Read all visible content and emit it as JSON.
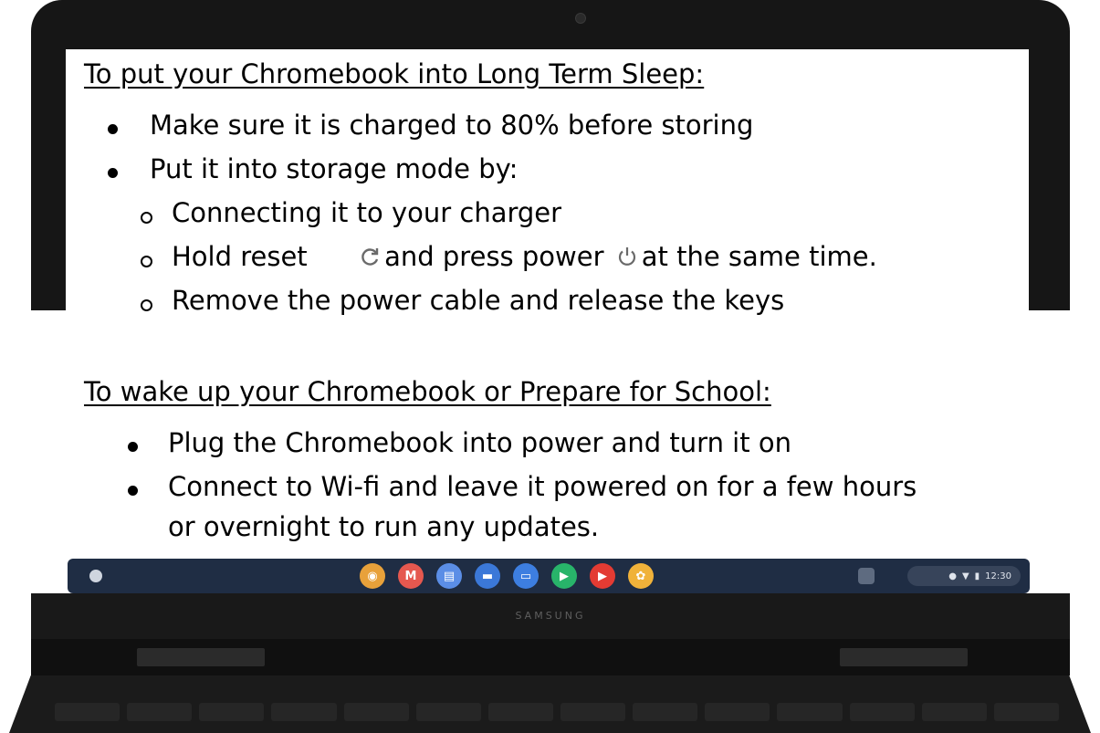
{
  "section1": {
    "heading": "To put your Chromebook into Long Term Sleep:",
    "bullets": [
      "Make sure it is charged to 80% before storing",
      "Put it into storage mode by:"
    ],
    "substeps": {
      "step1": "Connecting it to your charger",
      "step2_a": "Hold reset",
      "step2_b": "and press power",
      "step2_c": "at the same time.",
      "step3": "Remove the power cable and release the keys"
    }
  },
  "section2": {
    "heading": "To wake up your Chromebook or Prepare for School:",
    "bullets": [
      "Plug the Chromebook into power and turn it on",
      "Connect to Wi-fi and leave it powered on for a few hours",
      "or overnight to run any updates."
    ]
  },
  "taskbar": {
    "apps": [
      {
        "icon": "chrome-icon",
        "color": "#e8a13a",
        "glyph": "◉"
      },
      {
        "icon": "gmail-icon",
        "color": "#e5584f",
        "glyph": "M"
      },
      {
        "icon": "docs-icon",
        "color": "#5b8ee6",
        "glyph": "▤"
      },
      {
        "icon": "files-icon",
        "color": "#3b78d8",
        "glyph": "▬"
      },
      {
        "icon": "messages-icon",
        "color": "#3d7ee0",
        "glyph": "▭"
      },
      {
        "icon": "play-store-icon",
        "color": "#28b46a",
        "glyph": "▶"
      },
      {
        "icon": "youtube-icon",
        "color": "#e33b33",
        "glyph": "▶"
      },
      {
        "icon": "photos-icon",
        "color": "#f0b23a",
        "glyph": "✿"
      }
    ],
    "clock": "12:30"
  },
  "brand": "SAMSUNG",
  "icons": {
    "reset": "refresh-icon",
    "power": "power-icon"
  }
}
